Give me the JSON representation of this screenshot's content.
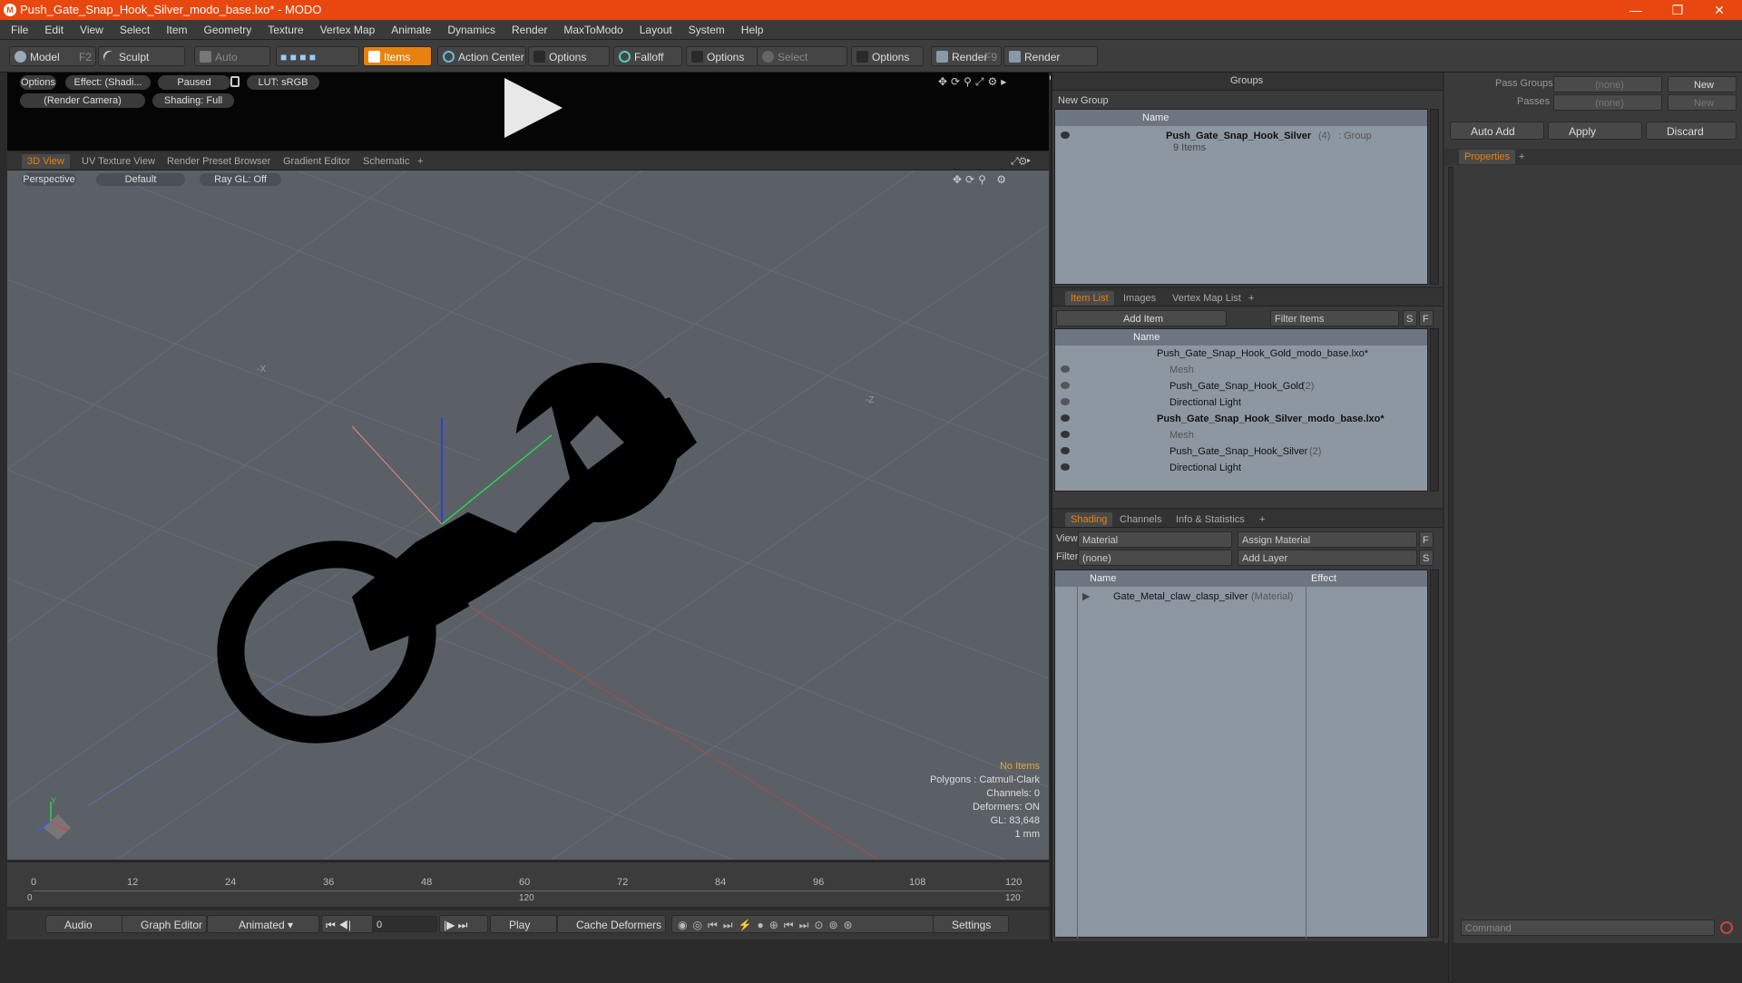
{
  "window": {
    "title": "Push_Gate_Snap_Hook_Silver_modo_base.lxo* - MODO",
    "minimize": "—",
    "restore": "❐",
    "close": "✕"
  },
  "menu": [
    "File",
    "Edit",
    "View",
    "Select",
    "Item",
    "Geometry",
    "Texture",
    "Vertex Map",
    "Animate",
    "Dynamics",
    "Render",
    "MaxToModo",
    "Layout",
    "System",
    "Help"
  ],
  "toolbar": {
    "model": "Model",
    "model_key": "F2",
    "sculpt": "Sculpt",
    "auto_select": "Auto Select",
    "items": "Items",
    "action_center": "Action Center",
    "options1": "Options",
    "falloff": "Falloff",
    "options2": "Options",
    "select_through": "Select Through",
    "options3": "Options",
    "render": "Render",
    "render_key": "F9",
    "render_window": "Render Window"
  },
  "preview": {
    "options": "Options",
    "effect": "Effect: (Shadi...",
    "paused": "Paused",
    "lut": "LUT: sRGB",
    "camera": "(Render Camera)",
    "shading": "Shading: Full"
  },
  "view_tabs": [
    "3D View",
    "UV Texture View",
    "Render Preset Browser",
    "Gradient Editor",
    "Schematic",
    "+"
  ],
  "viewport": {
    "perspective": "Perspective",
    "default": "Default",
    "raygl": "Ray GL: Off",
    "axis_x": "-X",
    "axis_z": "-Z",
    "axis_y": "Y"
  },
  "stats": {
    "no_items": "No Items",
    "polygons": "Polygons : Catmull-Clark",
    "channels": "Channels: 0",
    "deformers": "Deformers: ON",
    "gl": "GL: 83,648",
    "unit": "1 mm"
  },
  "timeline": {
    "ticks": [
      "0",
      "12",
      "24",
      "36",
      "48",
      "60",
      "72",
      "84",
      "96",
      "108",
      "120"
    ],
    "start": "0",
    "mid": "120",
    "end": "120"
  },
  "bottom": {
    "audio": "Audio",
    "graph_editor": "Graph Editor",
    "animated": "Animated",
    "frame": "0",
    "play": "Play",
    "cache": "Cache Deformers",
    "settings": "Settings"
  },
  "groups": {
    "title": "Groups",
    "new_group": "New Group",
    "col_name": "Name",
    "item_name": "Push_Gate_Snap_Hook_Silver",
    "item_count": "(4)",
    "item_type": ": Group",
    "item_sub": "9 Items"
  },
  "pass": {
    "pass_groups": "Pass Groups",
    "passes": "Passes",
    "none1": "(none)",
    "none2": "(none)",
    "new1": "New",
    "new2": "New",
    "auto_add": "Auto Add",
    "apply": "Apply",
    "discard": "Discard",
    "properties": "Properties",
    "plus": "+"
  },
  "itemlist": {
    "tabs": [
      "Item List",
      "Images",
      "Vertex Map List",
      "+"
    ],
    "add_item": "Add Item",
    "filter": "Filter Items",
    "s": "S",
    "f": "F",
    "col_name": "Name",
    "rows": [
      {
        "label": "Push_Gate_Snap_Hook_Gold_modo_base.lxo*",
        "suffix": "",
        "bold": false,
        "indent": 0,
        "gray": false
      },
      {
        "label": "Mesh",
        "suffix": "",
        "bold": false,
        "indent": 1,
        "gray": true
      },
      {
        "label": "Push_Gate_Snap_Hook_Gold",
        "suffix": "(2)",
        "bold": false,
        "indent": 1,
        "gray": false
      },
      {
        "label": "Directional Light",
        "suffix": "",
        "bold": false,
        "indent": 1,
        "gray": false
      },
      {
        "label": "Push_Gate_Snap_Hook_Silver_modo_base.lxo*",
        "suffix": "",
        "bold": true,
        "indent": 0,
        "gray": false
      },
      {
        "label": "Mesh",
        "suffix": "",
        "bold": false,
        "indent": 1,
        "gray": true
      },
      {
        "label": "Push_Gate_Snap_Hook_Silver",
        "suffix": "(2)",
        "bold": false,
        "indent": 1,
        "gray": false
      },
      {
        "label": "Directional Light",
        "suffix": "",
        "bold": false,
        "indent": 1,
        "gray": false
      }
    ]
  },
  "shading": {
    "tabs": [
      "Shading",
      "Channels",
      "Info & Statistics",
      "+"
    ],
    "view_label": "View",
    "view_value": "Material",
    "assign": "Assign Material",
    "filter_label": "Filter",
    "filter_value": "(none)",
    "add_layer": "Add Layer",
    "f": "F",
    "s": "S",
    "col_name": "Name",
    "col_effect": "Effect",
    "row_name": "Gate_Metal_claw_clasp_silver",
    "row_type": "(Material)"
  },
  "command": {
    "placeholder": "Command"
  }
}
